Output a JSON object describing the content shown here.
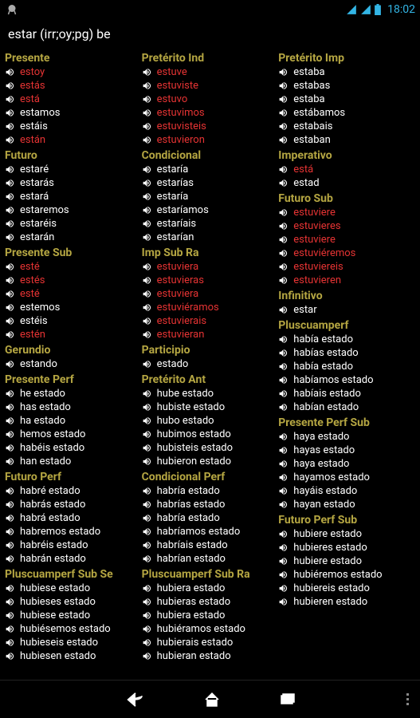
{
  "status": {
    "time": "18:02"
  },
  "header": {
    "title": "estar (irr;oy;pg) be"
  },
  "columns": [
    [
      {
        "title": "Presente",
        "forms": [
          {
            "w": "estoy",
            "irr": true
          },
          {
            "w": "estás",
            "irr": true
          },
          {
            "w": "está",
            "irr": true
          },
          {
            "w": "estamos",
            "irr": false
          },
          {
            "w": "estáis",
            "irr": false
          },
          {
            "w": "están",
            "irr": true
          }
        ]
      },
      {
        "title": "Futuro",
        "forms": [
          {
            "w": "estaré",
            "irr": false
          },
          {
            "w": "estarás",
            "irr": false
          },
          {
            "w": "estará",
            "irr": false
          },
          {
            "w": "estaremos",
            "irr": false
          },
          {
            "w": "estaréis",
            "irr": false
          },
          {
            "w": "estarán",
            "irr": false
          }
        ]
      },
      {
        "title": "Presente Sub",
        "forms": [
          {
            "w": "esté",
            "irr": true
          },
          {
            "w": "estés",
            "irr": true
          },
          {
            "w": "esté",
            "irr": true
          },
          {
            "w": "estemos",
            "irr": false
          },
          {
            "w": "estéis",
            "irr": false
          },
          {
            "w": "estén",
            "irr": true
          }
        ]
      },
      {
        "title": "Gerundio",
        "forms": [
          {
            "w": "estando",
            "irr": false
          }
        ]
      },
      {
        "title": "Presente Perf",
        "forms": [
          {
            "w": "he estado",
            "irr": false
          },
          {
            "w": "has estado",
            "irr": false
          },
          {
            "w": "ha estado",
            "irr": false
          },
          {
            "w": "hemos estado",
            "irr": false
          },
          {
            "w": "habéis estado",
            "irr": false
          },
          {
            "w": "han estado",
            "irr": false
          }
        ]
      },
      {
        "title": "Futuro Perf",
        "forms": [
          {
            "w": "habré estado",
            "irr": false
          },
          {
            "w": "habrás estado",
            "irr": false
          },
          {
            "w": "habrá estado",
            "irr": false
          },
          {
            "w": "habremos estado",
            "irr": false
          },
          {
            "w": "habréis estado",
            "irr": false
          },
          {
            "w": "habrán estado",
            "irr": false
          }
        ]
      },
      {
        "title": "Pluscuamperf Sub Se",
        "forms": [
          {
            "w": "hubiese estado",
            "irr": false
          },
          {
            "w": "hubieses estado",
            "irr": false
          },
          {
            "w": "hubiese estado",
            "irr": false
          },
          {
            "w": "hubiésemos estado",
            "irr": false
          },
          {
            "w": "hubieseis estado",
            "irr": false
          },
          {
            "w": "hubiesen estado",
            "irr": false
          }
        ]
      }
    ],
    [
      {
        "title": "Pretérito Ind",
        "forms": [
          {
            "w": "estuve",
            "irr": true
          },
          {
            "w": "estuviste",
            "irr": true
          },
          {
            "w": "estuvo",
            "irr": true
          },
          {
            "w": "estuvimos",
            "irr": true
          },
          {
            "w": "estuvisteis",
            "irr": true
          },
          {
            "w": "estuvieron",
            "irr": true
          }
        ]
      },
      {
        "title": "Condicional",
        "forms": [
          {
            "w": "estaría",
            "irr": false
          },
          {
            "w": "estarías",
            "irr": false
          },
          {
            "w": "estaría",
            "irr": false
          },
          {
            "w": "estaríamos",
            "irr": false
          },
          {
            "w": "estaríais",
            "irr": false
          },
          {
            "w": "estarían",
            "irr": false
          }
        ]
      },
      {
        "title": "Imp Sub Ra",
        "forms": [
          {
            "w": "estuviera",
            "irr": true
          },
          {
            "w": "estuvieras",
            "irr": true
          },
          {
            "w": "estuviera",
            "irr": true
          },
          {
            "w": "estuviéramos",
            "irr": true
          },
          {
            "w": "estuvierais",
            "irr": true
          },
          {
            "w": "estuvieran",
            "irr": true
          }
        ]
      },
      {
        "title": "Participio",
        "forms": [
          {
            "w": "estado",
            "irr": false
          }
        ]
      },
      {
        "title": "Pretérito Ant",
        "forms": [
          {
            "w": "hube estado",
            "irr": false
          },
          {
            "w": "hubiste estado",
            "irr": false
          },
          {
            "w": "hubo estado",
            "irr": false
          },
          {
            "w": "hubimos estado",
            "irr": false
          },
          {
            "w": "hubisteis estado",
            "irr": false
          },
          {
            "w": "hubieron estado",
            "irr": false
          }
        ]
      },
      {
        "title": "Condicional Perf",
        "forms": [
          {
            "w": "habría estado",
            "irr": false
          },
          {
            "w": "habrías estado",
            "irr": false
          },
          {
            "w": "habría estado",
            "irr": false
          },
          {
            "w": "habríamos estado",
            "irr": false
          },
          {
            "w": "habríais estado",
            "irr": false
          },
          {
            "w": "habrían estado",
            "irr": false
          }
        ]
      },
      {
        "title": "Pluscuamperf Sub Ra",
        "forms": [
          {
            "w": "hubiera estado",
            "irr": false
          },
          {
            "w": "hubieras estado",
            "irr": false
          },
          {
            "w": "hubiera estado",
            "irr": false
          },
          {
            "w": "hubiéramos estado",
            "irr": false
          },
          {
            "w": "hubierais estado",
            "irr": false
          },
          {
            "w": "hubieran estado",
            "irr": false
          }
        ]
      }
    ],
    [
      {
        "title": "Pretérito Imp",
        "forms": [
          {
            "w": "estaba",
            "irr": false
          },
          {
            "w": "estabas",
            "irr": false
          },
          {
            "w": "estaba",
            "irr": false
          },
          {
            "w": "estábamos",
            "irr": false
          },
          {
            "w": "estabais",
            "irr": false
          },
          {
            "w": "estaban",
            "irr": false
          }
        ]
      },
      {
        "title": "Imperativo",
        "forms": [
          {
            "w": "está",
            "irr": true
          },
          {
            "w": "estad",
            "irr": false
          }
        ]
      },
      {
        "title": "Futuro Sub",
        "forms": [
          {
            "w": "estuviere",
            "irr": true
          },
          {
            "w": "estuvieres",
            "irr": true
          },
          {
            "w": "estuviere",
            "irr": true
          },
          {
            "w": "estuviéremos",
            "irr": true
          },
          {
            "w": "estuviereis",
            "irr": true
          },
          {
            "w": "estuvieren",
            "irr": true
          }
        ]
      },
      {
        "title": "Infinitivo",
        "forms": [
          {
            "w": "estar",
            "irr": false
          }
        ]
      },
      {
        "title": "Pluscuamperf",
        "forms": [
          {
            "w": "había estado",
            "irr": false
          },
          {
            "w": "habías estado",
            "irr": false
          },
          {
            "w": "había estado",
            "irr": false
          },
          {
            "w": "habíamos estado",
            "irr": false
          },
          {
            "w": "habíais estado",
            "irr": false
          },
          {
            "w": "habían estado",
            "irr": false
          }
        ]
      },
      {
        "title": "Presente Perf Sub",
        "forms": [
          {
            "w": "haya estado",
            "irr": false
          },
          {
            "w": "hayas estado",
            "irr": false
          },
          {
            "w": "haya estado",
            "irr": false
          },
          {
            "w": "hayamos estado",
            "irr": false
          },
          {
            "w": "hayáis estado",
            "irr": false
          },
          {
            "w": "hayan estado",
            "irr": false
          }
        ]
      },
      {
        "title": "Futuro Perf Sub",
        "forms": [
          {
            "w": "hubiere estado",
            "irr": false
          },
          {
            "w": "hubieres estado",
            "irr": false
          },
          {
            "w": "hubiere estado",
            "irr": false
          },
          {
            "w": "hubiéremos estado",
            "irr": false
          },
          {
            "w": "hubiereis estado",
            "irr": false
          },
          {
            "w": "hubieren estado",
            "irr": false
          }
        ]
      }
    ]
  ]
}
